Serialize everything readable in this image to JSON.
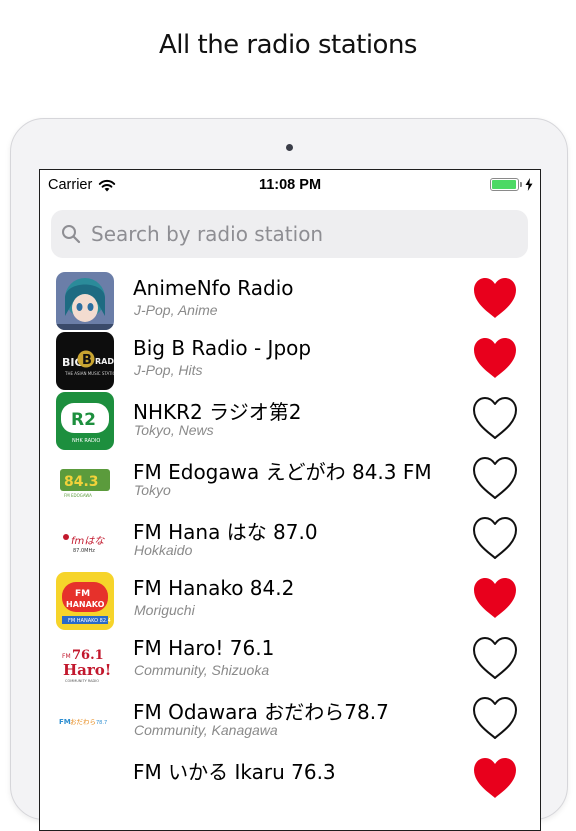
{
  "headline": "All the radio stations",
  "status": {
    "carrier": "Carrier",
    "time": "11:08 PM",
    "battery_level": 0.95
  },
  "search": {
    "placeholder": "Search by radio station"
  },
  "colors": {
    "heart_filled": "#e8001c",
    "battery": "#4cd964"
  },
  "stations": [
    {
      "name": "AnimeNfo Radio",
      "genre": "J-Pop, Anime",
      "favorite": true
    },
    {
      "name": "Big B Radio - Jpop",
      "genre": "J-Pop, Hits",
      "favorite": true,
      "logo_text": "B",
      "logo_caption": "BIG RADIO"
    },
    {
      "name": "NHKR2 ラジオ第2",
      "genre": "Tokyo, News",
      "favorite": false,
      "logo_text": "R2"
    },
    {
      "name": "FM Edogawa えどがわ 84.3 FM",
      "genre": "Tokyo",
      "favorite": false,
      "logo_text": "84.3"
    },
    {
      "name": "FM Hana はな 87.0",
      "genre": "Hokkaido",
      "favorite": false,
      "logo_text": "fmはな",
      "logo_caption": "87.0MHz"
    },
    {
      "name": "FM Hanako 84.2",
      "genre": "Moriguchi",
      "favorite": true,
      "logo_text": "FM HANAKO"
    },
    {
      "name": "FM Haro! 76.1",
      "genre": "Community, Shizuoka",
      "favorite": false,
      "logo_text": "76.1",
      "logo_caption": "Haro!"
    },
    {
      "name": "FM Odawara おだわら78.7",
      "genre": "Community, Kanagawa",
      "favorite": false,
      "logo_text": "FM おだわら 78.7MHz"
    },
    {
      "name": "FM いかる Ikaru 76.3",
      "genre": "",
      "favorite": true
    }
  ]
}
